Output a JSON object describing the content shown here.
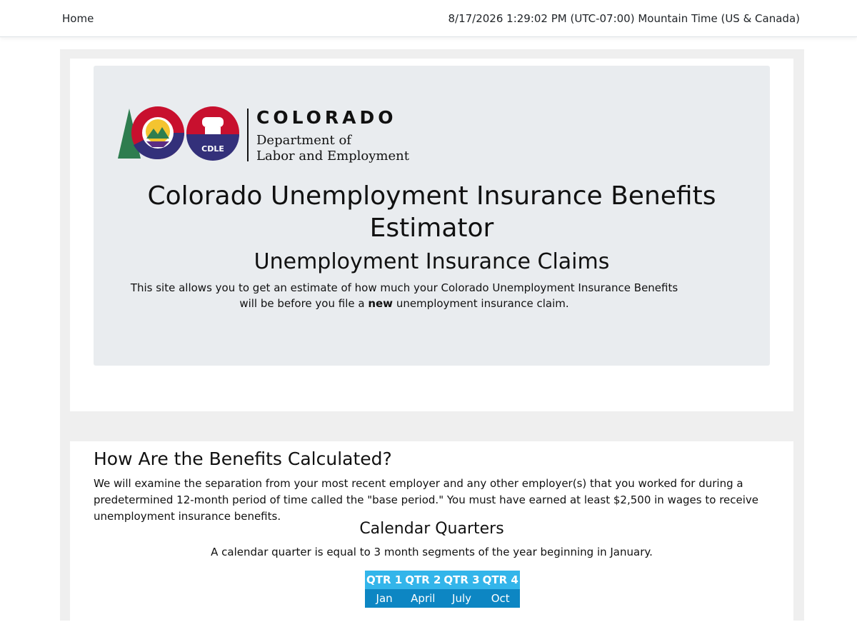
{
  "nav": {
    "home_label": "Home",
    "timestamp": "8/17/2026 1:29:02 PM (UTC-07:00) Mountain Time (US & Canada)"
  },
  "header": {
    "logo_word": "COLORADO",
    "logo_dept_line1": "Department of",
    "logo_dept_line2": "Labor and Employment",
    "logo_badge": "CDLE",
    "title": "Colorado Unemployment Insurance Benefits Estimator",
    "subtitle": "Unemployment Insurance Claims",
    "intro_before": "This site allows you to get an estimate of how much your Colorado Unemployment Insurance Benefits will be before you file a ",
    "intro_bold": "new",
    "intro_after": " unemployment insurance claim."
  },
  "benefits": {
    "title": "How Are the Benefits Calculated?",
    "body": "We will examine the separation from your most recent employer and any other employer(s) that you worked for during a predetermined 12-month period of time called the \"base period.\" You must have earned at least $2,500 in wages to receive unemployment insurance benefits."
  },
  "quarters": {
    "title": "Calendar Quarters",
    "body": "A calendar quarter is equal to 3 month segments of the year beginning in January.",
    "headers": [
      "QTR 1",
      "QTR 2",
      "QTR 3",
      "QTR 4"
    ],
    "months": [
      "Jan",
      "April",
      "July",
      "Oct"
    ]
  },
  "colors": {
    "header_bg": "#33b5ea",
    "cell_bg": "#0d86c3",
    "jumbotron_bg": "#e9ecef"
  }
}
